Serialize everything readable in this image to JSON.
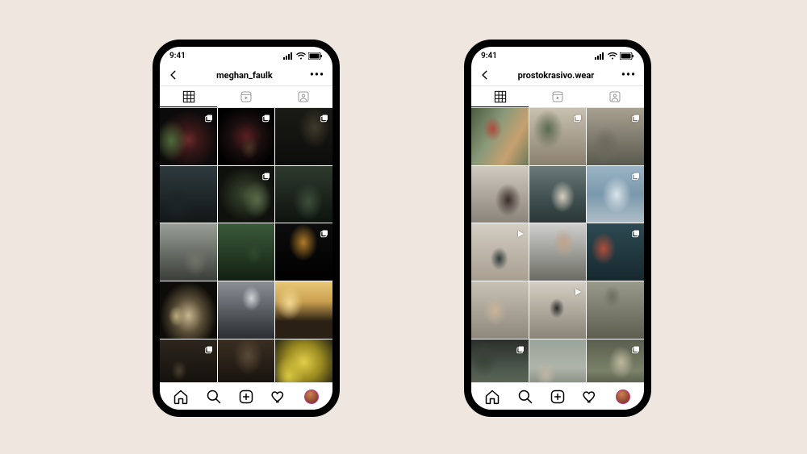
{
  "statusbar": {
    "time": "9:41"
  },
  "phones": [
    {
      "username": "meghan_faulk",
      "cells": [
        {
          "bg": "radial-gradient(circle at 50% 55%, #6b2b2e 0%, #3a1818 25%, #0b0b0b 70%)",
          "accent": "#4e6b3a",
          "badge": "carousel"
        },
        {
          "bg": "radial-gradient(circle at 50% 50%, #5a1f22 0%, #1a0e0e 40%, #000 80%)",
          "accent": "#432",
          "badge": "carousel"
        },
        {
          "bg": "linear-gradient(#1a1a16,#0c0c0a)",
          "accent": "#3f3a2a",
          "badge": "carousel"
        },
        {
          "bg": "linear-gradient(#2e3a3e,#121616)",
          "accent": "#1d2427",
          "badge": null
        },
        {
          "bg": "radial-gradient(circle at 50% 50%, #3d4a32 0%, #0e110c 70%)",
          "accent": "#5b6b4a",
          "badge": "carousel"
        },
        {
          "bg": "linear-gradient(#2e3a2e,#0d120d)",
          "accent": "#3d4e3a",
          "badge": null
        },
        {
          "bg": "linear-gradient(#9aa098,#3a3d38)",
          "accent": "#707368",
          "badge": null
        },
        {
          "bg": "linear-gradient(#3b5a3b,#122012)",
          "accent": "#2e4a2e",
          "badge": null
        },
        {
          "bg": "linear-gradient(#0d0d0d,#000)",
          "accent": "#b07a2a",
          "badge": "carousel"
        },
        {
          "bg": "radial-gradient(ellipse at 50% 60%, #c8b890 0%, #5a4e38 35%, #0e0c08 70%)",
          "accent": "#b8a87a",
          "badge": null
        },
        {
          "bg": "linear-gradient(#8a9096,#2a2e32)",
          "accent": "#cfd4d8",
          "badge": null
        },
        {
          "bg": "linear-gradient(#e8c878 0%, #caa050 35%, #2a2014 70%)",
          "accent": "#f2d890",
          "badge": null
        },
        {
          "bg": "linear-gradient(#2d261e,#0c0a07)",
          "accent": "#4a3e2e",
          "badge": "carousel"
        },
        {
          "bg": "linear-gradient(#3a2e22,#0e0b08)",
          "accent": "#5a4a36",
          "badge": null
        },
        {
          "bg": "radial-gradient(circle at 50% 40%, #e2cf4a 0%, #9a8a20 40%, #1c1c14 85%)",
          "accent": "#d8c840",
          "badge": null
        }
      ]
    },
    {
      "username": "prostokrasivo.wear",
      "cells": [
        {
          "bg": "linear-gradient(120deg,#4a5a3e 0%, #8a9a7a 40%, #c7a070 70%, #6a7a5a 100%)",
          "accent": "#b04a3a",
          "badge": null
        },
        {
          "bg": "linear-gradient(#c8c0b0,#8a8070)",
          "accent": "#5a6a4e",
          "badge": "carousel"
        },
        {
          "bg": "linear-gradient(#a8a090,#5a5a4e)",
          "accent": "#6a6a5a",
          "badge": "carousel"
        },
        {
          "bg": "linear-gradient(#d0cac0,#8a847a)",
          "accent": "#3a2e28",
          "badge": null
        },
        {
          "bg": "linear-gradient(#6a7a7a 0%, #3e4e4e 60%, #2a3636 100%)",
          "accent": "#d8d0c0",
          "badge": null
        },
        {
          "bg": "linear-gradient(#9ab4c4 0%, #7a98ac 50%, #aebec8 100%)",
          "accent": "#dce4ea",
          "badge": "carousel"
        },
        {
          "bg": "linear-gradient(#d4cec4,#a89e90)",
          "accent": "#2e3a3a",
          "badge": "video"
        },
        {
          "bg": "linear-gradient(#cfd0ce 0%, #9a9a94 55%, #6a6a62 100%)",
          "accent": "#bfa488",
          "badge": null
        },
        {
          "bg": "linear-gradient(#2e4a52,#16282e)",
          "accent": "#b04e3a",
          "badge": "carousel"
        },
        {
          "bg": "linear-gradient(#c8c2b6,#8e887c)",
          "accent": "#c8b49a",
          "badge": null
        },
        {
          "bg": "linear-gradient(#d4cec4,#8a8478)",
          "accent": "#2a2a2a",
          "badge": "video"
        },
        {
          "bg": "linear-gradient(#9a9a8a,#5e5e50)",
          "accent": "#6e6e5e",
          "badge": null
        },
        {
          "bg": "linear-gradient(#2a2e2a 0%, #4e5a4e 55%, #6a7260 100%)",
          "accent": "#3a4238",
          "badge": "carousel"
        },
        {
          "bg": "linear-gradient(#9aa49a 0%, #aeb4aa 50%, #6e7468 100%)",
          "accent": "#c0b6a4",
          "badge": null
        },
        {
          "bg": "linear-gradient(#5a5e4e 0%, #7a8268 55%, #3a3e32 100%)",
          "accent": "#c0b8a0",
          "badge": "carousel"
        }
      ]
    }
  ]
}
